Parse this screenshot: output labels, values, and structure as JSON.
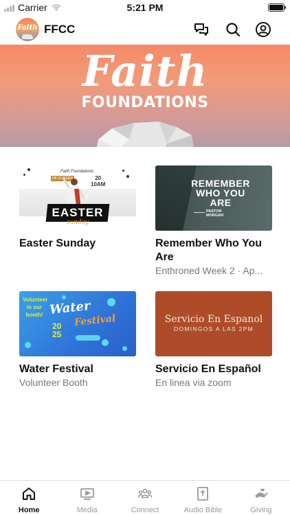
{
  "status_bar": {
    "carrier": "Carrier",
    "time": "5:21 PM",
    "battery": 1.0
  },
  "header": {
    "logo_text": "Faith",
    "title": "FFCC",
    "icons": [
      "chat-icon",
      "search-icon",
      "profile-icon"
    ]
  },
  "hero": {
    "script_title": "Faith",
    "subtitle": "FOUNDATIONS"
  },
  "cards": [
    {
      "title": "Easter Sunday",
      "subtitle": "",
      "thumb": {
        "header": "Faith Foundations",
        "badge": "HE IS RISEN",
        "date_1": "20",
        "date_2": "10AM",
        "word": "EASTER",
        "script": "sunday"
      }
    },
    {
      "title": "Remember Who You Are",
      "subtitle": "Enthroned Week 2 · Ap...",
      "thumb": {
        "line1": "REMEMBER",
        "line2": "WHO YOU",
        "line3": "ARE",
        "pastor_1": "PASTOR",
        "pastor_2": "MORGAN"
      }
    },
    {
      "title": "Water Festival",
      "subtitle": "Volunteer Booth",
      "thumb": {
        "volunteer": "Volunteer in our booth!",
        "word_1": "Water",
        "word_2": "Festival",
        "year_1": "20",
        "year_2": "25"
      }
    },
    {
      "title": "Servicio En Español",
      "subtitle": "En linea via zoom",
      "thumb": {
        "title": "Servicio En Espanol",
        "subtitle": "DOMINGOS A LAS 2PM"
      }
    }
  ],
  "tabs": [
    {
      "label": "Home",
      "icon": "home-icon",
      "active": true
    },
    {
      "label": "Media",
      "icon": "media-icon",
      "active": false
    },
    {
      "label": "Connect",
      "icon": "people-icon",
      "active": false
    },
    {
      "label": "Audio Bible",
      "icon": "bible-icon",
      "active": false
    },
    {
      "label": "Giving",
      "icon": "giving-hand-icon",
      "active": false
    }
  ],
  "colors": {
    "accent": "#111111",
    "inactive": "#9a9a9a",
    "hero_top": "#f48a68",
    "servicio_bg": "#ae4c2a"
  }
}
